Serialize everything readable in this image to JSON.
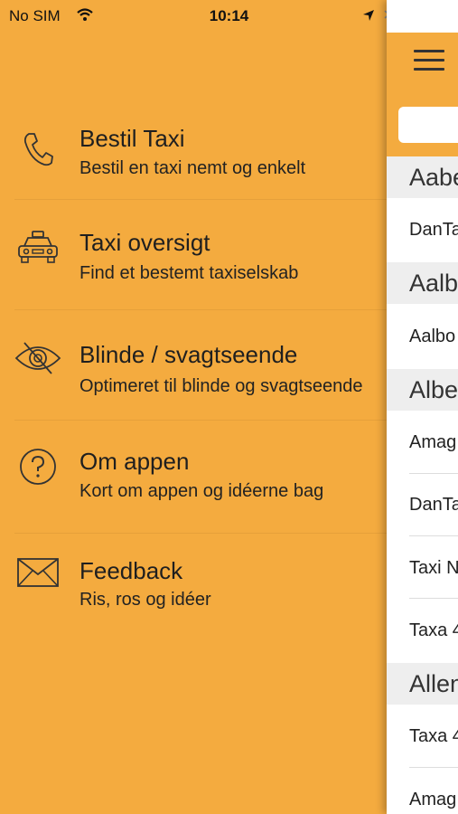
{
  "status_bar": {
    "carrier": "No SIM",
    "time": "10:14"
  },
  "menu": {
    "items": [
      {
        "title": "Bestil Taxi",
        "subtitle": "Bestil en taxi nemt og enkelt",
        "icon": "phone-icon"
      },
      {
        "title": "Taxi oversigt",
        "subtitle": "Find et bestemt taxiselskab",
        "icon": "taxi-icon"
      },
      {
        "title": "Blinde / svagtseende",
        "subtitle": "Optimeret til blinde og svagtseende",
        "icon": "eye-slash-icon"
      },
      {
        "title": "Om appen",
        "subtitle": "Kort om appen og idéerne bag",
        "icon": "question-icon"
      },
      {
        "title": "Feedback",
        "subtitle": "Ris, ros og idéer",
        "icon": "envelope-icon"
      }
    ]
  },
  "panel": {
    "sections": [
      {
        "header": "Aabe",
        "rows": [
          "DanTa"
        ]
      },
      {
        "header": "Aalb",
        "rows": [
          "Aalbo"
        ]
      },
      {
        "header": "Albe",
        "rows": [
          "Amag",
          "DanTa",
          "Taxi N",
          "Taxa 4"
        ]
      },
      {
        "header": "Allen",
        "rows": [
          "Taxa 4",
          "Amag"
        ]
      }
    ]
  },
  "colors": {
    "accent": "#f4ab3f",
    "battery": "#5fd03a"
  }
}
